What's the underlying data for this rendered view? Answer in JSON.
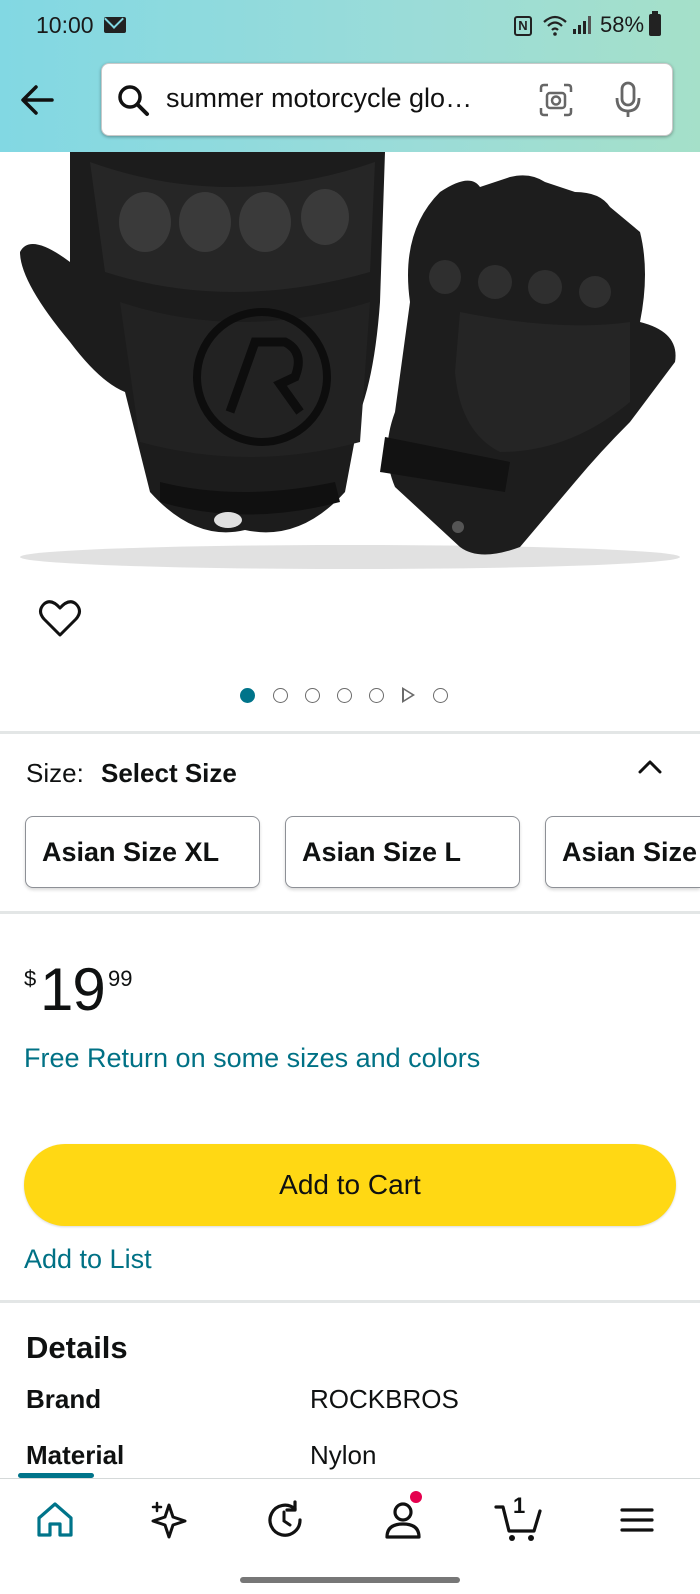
{
  "status_bar": {
    "time": "10:00",
    "battery": "58%"
  },
  "search": {
    "query": "summer motorcycle glo…"
  },
  "gallery": {
    "total_items": 7,
    "active_index": 0
  },
  "size": {
    "label": "Size:",
    "value": "Select Size",
    "options": [
      "Asian Size XL",
      "Asian Size L",
      "Asian Size"
    ]
  },
  "price": {
    "symbol": "$",
    "whole": "19",
    "fraction": "99"
  },
  "free_return": "Free Return on some sizes and colors",
  "buttons": {
    "add_to_cart": "Add to Cart",
    "add_to_list": "Add to List"
  },
  "details": {
    "title": "Details",
    "rows": [
      {
        "key": "Brand",
        "value": "ROCKBROS"
      },
      {
        "key": "Material",
        "value": "Nylon"
      }
    ]
  },
  "bottom_nav": {
    "cart_count": "1",
    "active": "home"
  },
  "colors": {
    "accent": "#00748a",
    "link": "#007185",
    "cart_button": "#ffd814",
    "notification": "#e5004e"
  }
}
